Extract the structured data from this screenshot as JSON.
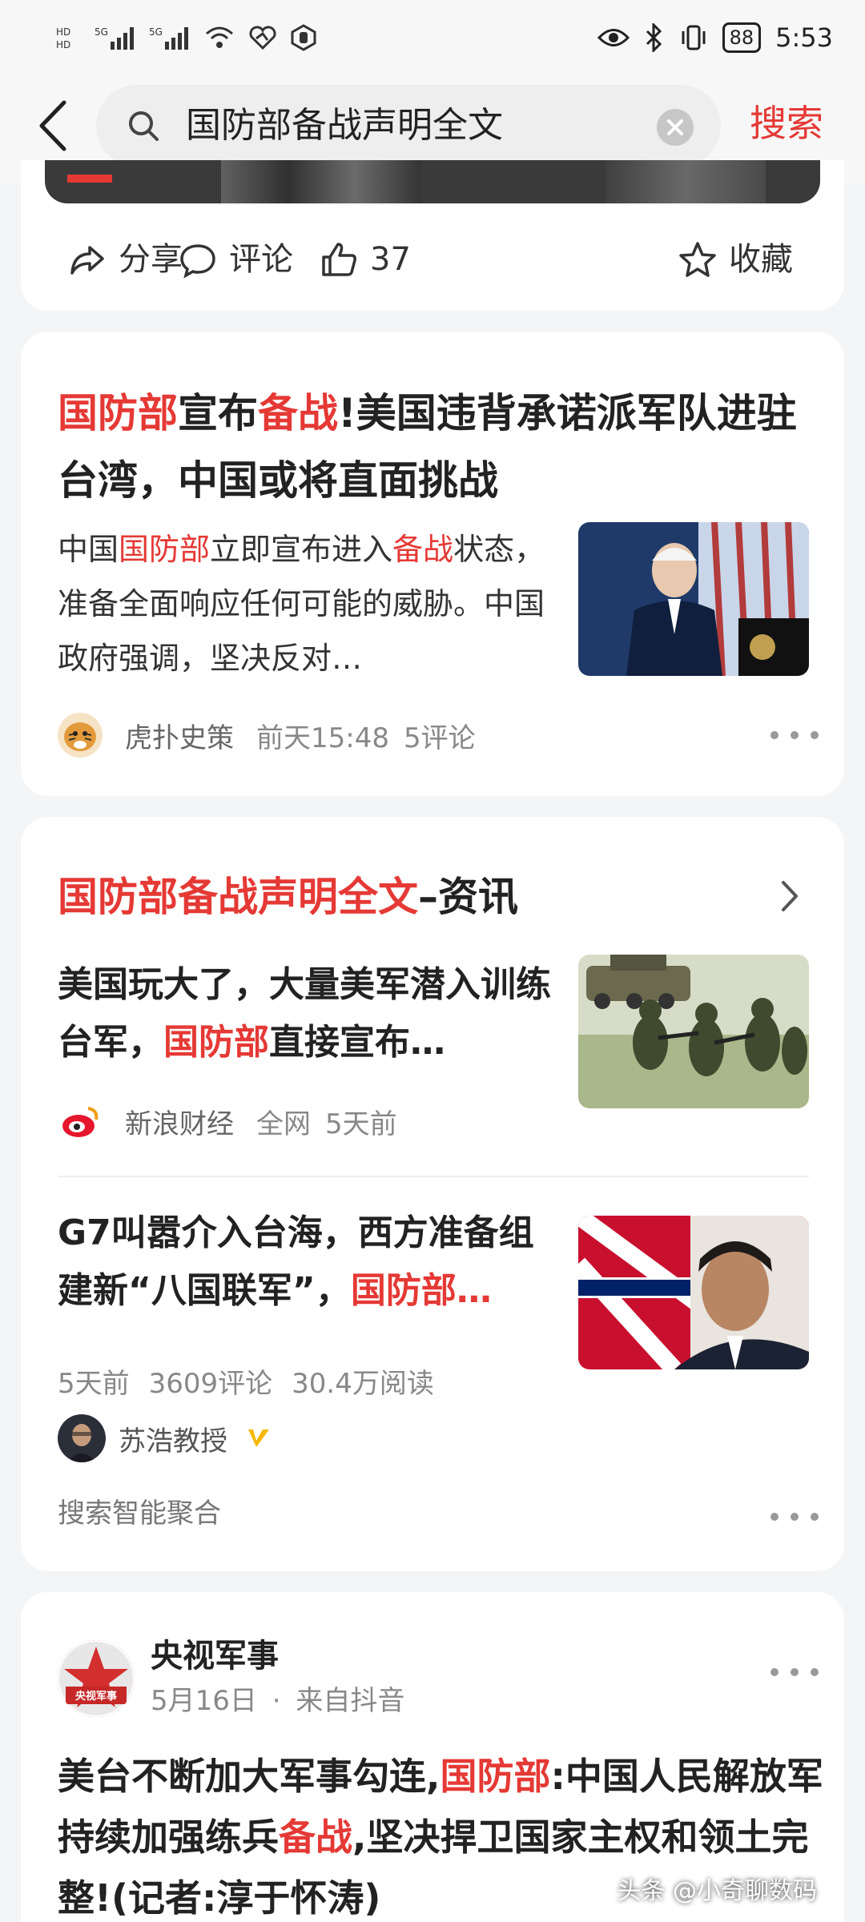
{
  "status_bar": {
    "left_icons": [
      "hd-icon",
      "signal-5g-icon",
      "signal-5g-icon",
      "wifi-icon",
      "heart-icon",
      "hand-icon"
    ],
    "battery": "88",
    "time": "5:53"
  },
  "search": {
    "query": "国防部备战声明全文",
    "submit_label": "搜索"
  },
  "card0": {
    "share": "分享",
    "comment": "评论",
    "like_count": "37",
    "collect": "收藏"
  },
  "card1": {
    "title": [
      {
        "t": "国防部",
        "hl": true
      },
      {
        "t": "宣布",
        "hl": false
      },
      {
        "t": "备战",
        "hl": true
      },
      {
        "t": "!美国违背承诺派军队进驻台湾，中国或将直面挑战",
        "hl": false
      }
    ],
    "snippet": [
      {
        "t": "中国",
        "hl": false
      },
      {
        "t": "国防部",
        "hl": true
      },
      {
        "t": "立即宣布进入",
        "hl": false
      },
      {
        "t": "备战",
        "hl": true
      },
      {
        "t": "状态，准备全面响应任何可能的威胁。中国政府强调，坚决反对…",
        "hl": false
      }
    ],
    "source": "虎扑史策",
    "time": "前天15:48",
    "comments": "5评论"
  },
  "card2": {
    "heading_hl": "国防部备战声明全文",
    "heading_suffix": "–资讯",
    "item1": {
      "title": [
        {
          "t": "美国玩大了，大量美军潜入训练台军，",
          "hl": false
        },
        {
          "t": "国防部",
          "hl": true
        },
        {
          "t": "直接宣布…",
          "hl": false
        }
      ],
      "source": "新浪财经",
      "scope": "全网",
      "time": "5天前"
    },
    "item2": {
      "title": [
        {
          "t": "G7叫嚣介入台海，西方准备组建新“八国联军”，",
          "hl": false
        },
        {
          "t": "国防部…",
          "hl": true
        }
      ],
      "time": "5天前",
      "comments": "3609评论",
      "reads": "30.4万阅读",
      "author": "苏浩教授"
    },
    "aggregation": "搜索智能聚合"
  },
  "card3": {
    "author": "央视军事",
    "logo_text": "央视军事",
    "date": "5月16日",
    "sep": "·",
    "origin": "来自抖音",
    "title": [
      {
        "t": "美台不断加大军事勾连,",
        "hl": false
      },
      {
        "t": "国防部",
        "hl": true
      },
      {
        "t": ":中国人民解放军持续加强练兵",
        "hl": false
      },
      {
        "t": "备战",
        "hl": true
      },
      {
        "t": ",坚决捍卫国家主权和领土完整!(记者:淳于怀涛)",
        "hl": false
      }
    ]
  },
  "watermark": "头条 @小奇聊数码",
  "colors": {
    "highlight": "#e53935",
    "background": "#f4f5f6",
    "card": "#ffffff"
  }
}
